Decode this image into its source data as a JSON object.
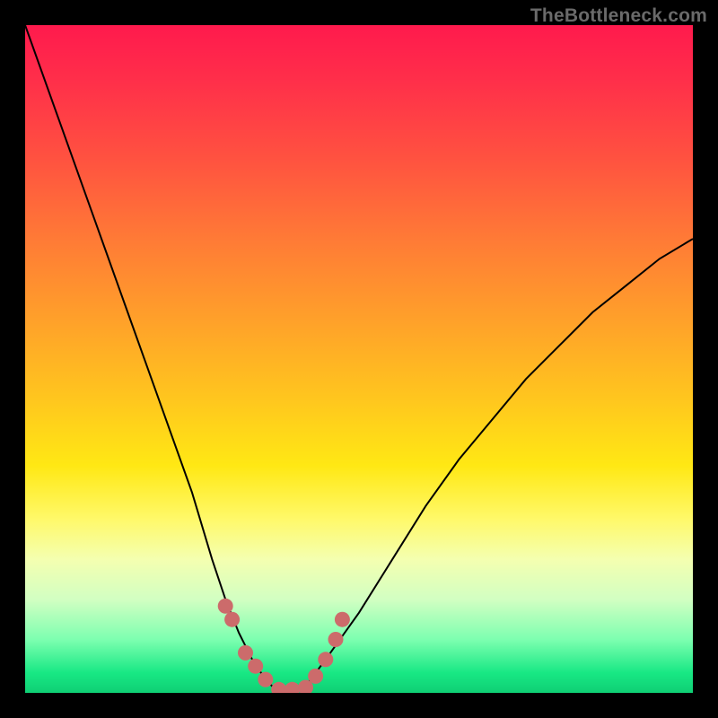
{
  "watermark": "TheBottleneck.com",
  "chart_data": {
    "type": "line",
    "title": "",
    "xlabel": "",
    "ylabel": "",
    "xlim": [
      0,
      100
    ],
    "ylim": [
      0,
      100
    ],
    "grid": false,
    "series": [
      {
        "name": "bottleneck-curve",
        "x": [
          0,
          5,
          10,
          15,
          20,
          25,
          28,
          30,
          32,
          34,
          36,
          38,
          40,
          42,
          45,
          50,
          55,
          60,
          65,
          70,
          75,
          80,
          85,
          90,
          95,
          100
        ],
        "values": [
          100,
          86,
          72,
          58,
          44,
          30,
          20,
          14,
          9,
          5,
          2,
          0,
          0,
          1,
          5,
          12,
          20,
          28,
          35,
          41,
          47,
          52,
          57,
          61,
          65,
          68
        ]
      }
    ],
    "markers": {
      "name": "highlight-dots",
      "color": "#cc6b6b",
      "x": [
        30,
        31,
        33,
        34.5,
        36,
        38,
        40,
        42,
        43.5,
        45,
        46.5,
        47.5
      ],
      "values": [
        13,
        11,
        6,
        4,
        2,
        0.5,
        0.5,
        0.8,
        2.5,
        5,
        8,
        11
      ]
    }
  }
}
